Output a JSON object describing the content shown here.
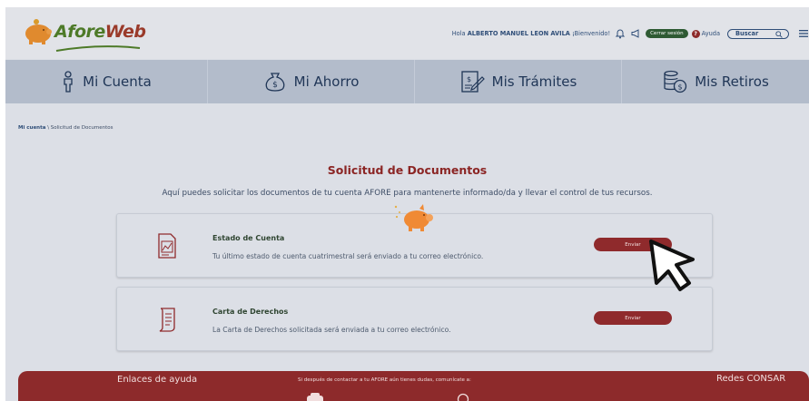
{
  "header": {
    "logo": {
      "part1": "Afore",
      "part2": "Web"
    },
    "greeting_prefix": "Hola",
    "user_name": "ALBERTO MANUEL LEON AVILA",
    "greeting_suffix": "¡Bienvenido!",
    "logout_label": "Cerrar sesión",
    "help_label": "Ayuda",
    "search_label": "Buscar"
  },
  "nav": {
    "items": [
      {
        "label": "Mi Cuenta",
        "icon": "person-icon"
      },
      {
        "label": "Mi Ahorro",
        "icon": "money-bag-icon"
      },
      {
        "label": "Mis Trámites",
        "icon": "document-edit-icon"
      },
      {
        "label": "Mis Retiros",
        "icon": "coins-icon"
      }
    ]
  },
  "breadcrumb": {
    "home": "Mi cuenta",
    "separator": "\\",
    "current": "Solicitud de Documentos"
  },
  "main": {
    "title": "Solicitud de Documentos",
    "intro": "Aquí puedes solicitar los documentos de tu cuenta AFORE para mantenerte informado/da y llevar el control de tus recursos.",
    "cards": [
      {
        "title": "Estado de Cuenta",
        "description": "Tu último estado de cuenta cuatrimestral será enviado a tu correo electrónico.",
        "button": "Enviar",
        "icon": "statement-icon"
      },
      {
        "title": "Carta de Derechos",
        "description": "La Carta de Derechos solicitada será enviada a tu correo electrónico.",
        "button": "Enviar",
        "icon": "scroll-document-icon"
      }
    ]
  },
  "footer": {
    "help_links": "Enlaces de ayuda",
    "contact_text": "Si después de contactar a tu AFORE aún tienes dudas, comunícate a:",
    "social": "Redes CONSAR"
  },
  "colors": {
    "brand_red": "#8f2a2c",
    "brand_green": "#4d7a28",
    "nav_bg": "#b3bccb",
    "title_text": "#8b2524"
  }
}
